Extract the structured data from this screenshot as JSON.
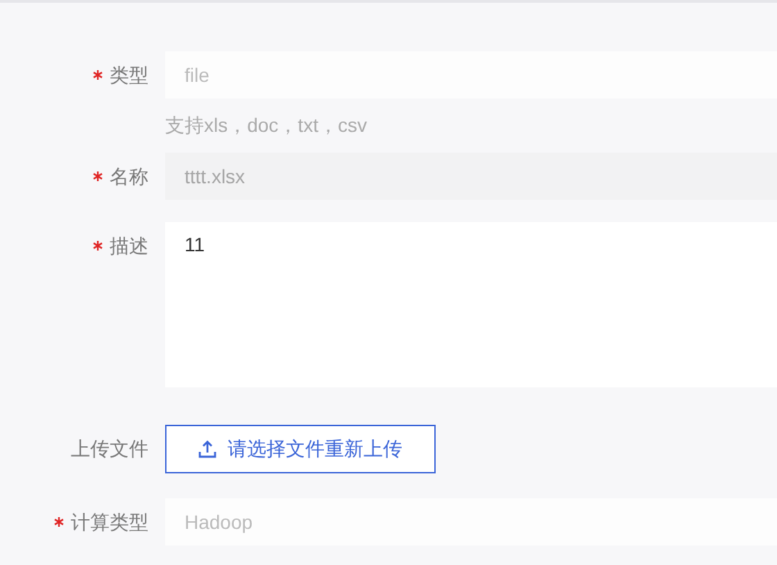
{
  "form": {
    "fields": [
      {
        "kind": "input",
        "label": "类型",
        "required": true,
        "placeholder": "file",
        "hint": "支持xls，doc，txt，csv"
      },
      {
        "kind": "input",
        "label": "名称",
        "required": true,
        "value": "tttt.xlsx",
        "disabled": true
      },
      {
        "kind": "textarea",
        "label": "描述",
        "required": true,
        "value": "11"
      },
      {
        "kind": "upload",
        "label": "上传文件",
        "required": false,
        "button": "请选择文件重新上传"
      },
      {
        "kind": "input",
        "label": "计算类型",
        "required": true,
        "placeholder": "Hadoop"
      }
    ]
  }
}
